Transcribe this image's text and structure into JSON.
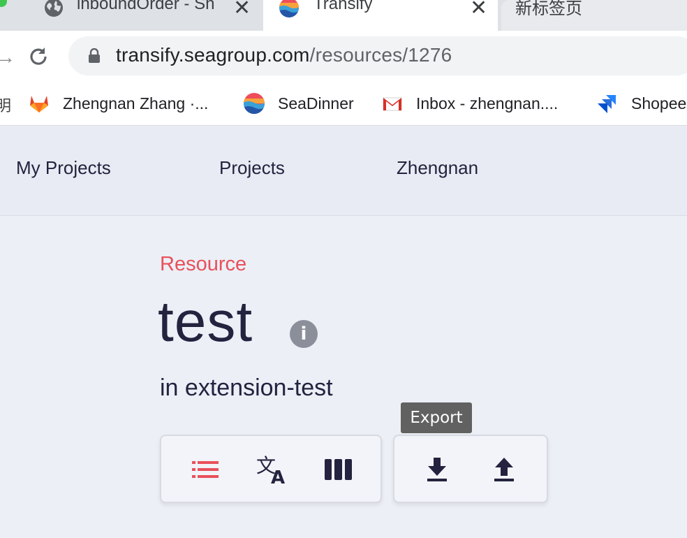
{
  "browser": {
    "tabs": [
      {
        "title": "inboundOrder - Sh",
        "icon": "globe-icon",
        "active": false
      },
      {
        "title": "Transify",
        "icon": "transify-logo-icon",
        "active": true
      },
      {
        "title": "新标签页",
        "icon": "",
        "active": false
      }
    ],
    "url_host": "transify.seagroup.com",
    "url_path": "/resources/1276",
    "bookmarks": [
      {
        "label": "Zhengnan Zhang ·...",
        "icon": "gitlab-icon"
      },
      {
        "label": "SeaDinner",
        "icon": "seadinner-logo-icon"
      },
      {
        "label": "Inbox - zhengnan....",
        "icon": "gmail-icon"
      },
      {
        "label": "Shopee",
        "icon": "jira-icon"
      }
    ],
    "bookmark_cut_glyph": "明"
  },
  "nav": {
    "items": [
      "My Projects",
      "Projects",
      "Zhengnan"
    ]
  },
  "resource": {
    "label": "Resource",
    "name": "test",
    "info_glyph": "i",
    "context": "in extension-test"
  },
  "toolbar": {
    "view_buttons": [
      {
        "icon": "list-icon",
        "active": true
      },
      {
        "icon": "translate-icon",
        "active": false
      },
      {
        "icon": "columns-icon",
        "active": false
      }
    ],
    "io_buttons": [
      {
        "icon": "download-icon"
      },
      {
        "icon": "upload-icon"
      }
    ],
    "tooltip": "Export"
  },
  "colors": {
    "accent": "#e8505b",
    "text_dark": "#23233f",
    "page_bg": "#eceff6"
  }
}
